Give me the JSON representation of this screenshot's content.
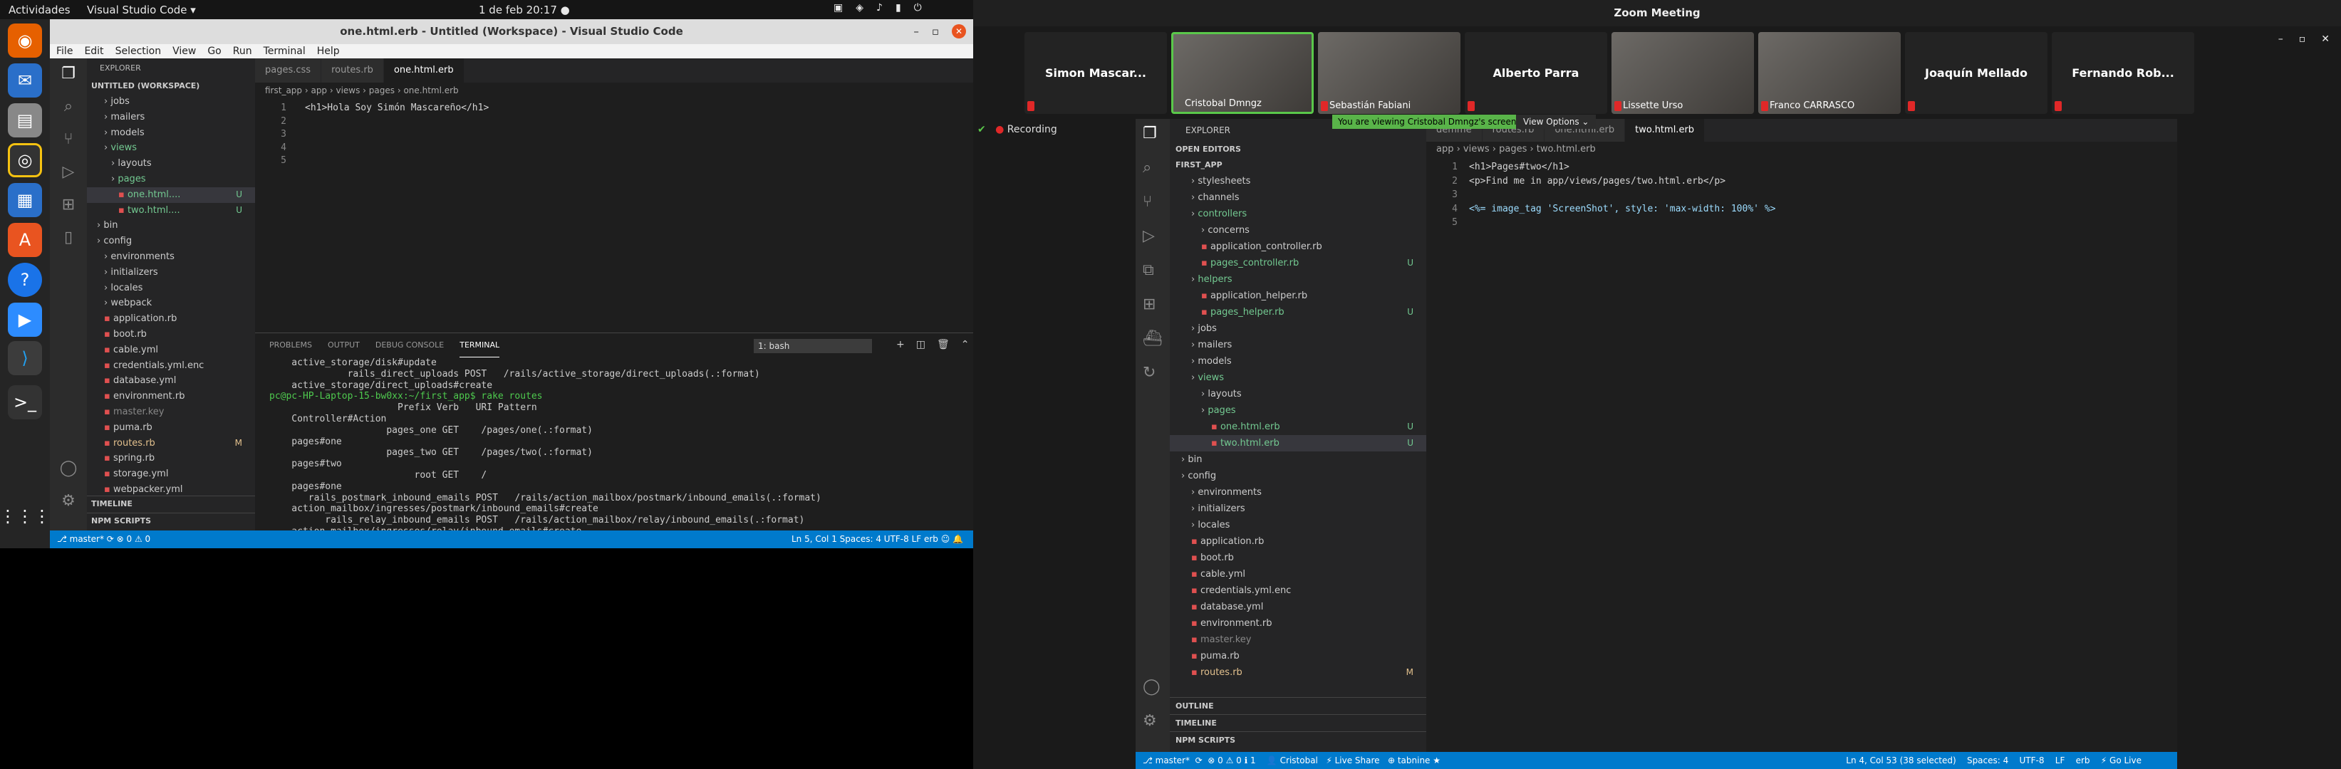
{
  "topbar": {
    "activities": "Actividades",
    "app": "Visual Studio Code ▾",
    "clock": "1 de feb  20:17  ●"
  },
  "vscode": {
    "title": "one.html.erb - Untitled (Workspace) - Visual Studio Code",
    "menu": [
      "File",
      "Edit",
      "Selection",
      "View",
      "Go",
      "Run",
      "Terminal",
      "Help"
    ],
    "explorer_label": "EXPLORER",
    "workspace": "UNTITLED (WORKSPACE)",
    "tree": [
      {
        "t": "jobs",
        "d": 1,
        "f": 1
      },
      {
        "t": "mailers",
        "d": 1,
        "f": 1
      },
      {
        "t": "models",
        "d": 1,
        "f": 1
      },
      {
        "t": "views",
        "d": 1,
        "f": 1,
        "c": "#73c991"
      },
      {
        "t": "layouts",
        "d": 2,
        "f": 1
      },
      {
        "t": "pages",
        "d": 2,
        "f": 1,
        "c": "#73c991"
      },
      {
        "t": "one.html....",
        "d": 3,
        "m": "U",
        "c": "#73c991",
        "sel": true
      },
      {
        "t": "two.html....",
        "d": 3,
        "m": "U",
        "c": "#73c991"
      },
      {
        "t": "bin",
        "d": 0,
        "f": 1
      },
      {
        "t": "config",
        "d": 0,
        "f": 1
      },
      {
        "t": "environments",
        "d": 1,
        "f": 1
      },
      {
        "t": "initializers",
        "d": 1,
        "f": 1
      },
      {
        "t": "locales",
        "d": 1,
        "f": 1
      },
      {
        "t": "webpack",
        "d": 1,
        "f": 1
      },
      {
        "t": "application.rb",
        "d": 1
      },
      {
        "t": "boot.rb",
        "d": 1
      },
      {
        "t": "cable.yml",
        "d": 1
      },
      {
        "t": "credentials.yml.enc",
        "d": 1
      },
      {
        "t": "database.yml",
        "d": 1
      },
      {
        "t": "environment.rb",
        "d": 1
      },
      {
        "t": "master.key",
        "d": 1,
        "c": "#888"
      },
      {
        "t": "puma.rb",
        "d": 1
      },
      {
        "t": "routes.rb",
        "d": 1,
        "m": "M",
        "c": "#e2c08d"
      },
      {
        "t": "spring.rb",
        "d": 1
      },
      {
        "t": "storage.yml",
        "d": 1
      },
      {
        "t": "webpacker.yml",
        "d": 1
      }
    ],
    "timeline": "TIMELINE",
    "npm": "NPM SCRIPTS",
    "tabs": [
      "pages.css",
      "routes.rb",
      "one.html.erb"
    ],
    "crumb": "first_app › app › views › pages › one.html.erb",
    "lines": [
      "1",
      "2",
      "3",
      "4",
      "5"
    ],
    "code": [
      "<h1>Hola Soy Simón Mascareño</h1>",
      "",
      "",
      "",
      ""
    ],
    "panel_tabs": [
      "PROBLEMS",
      "OUTPUT",
      "DEBUG CONSOLE",
      "TERMINAL"
    ],
    "shell": "1: bash",
    "terminal": [
      "    active_storage/disk#update",
      "              rails_direct_uploads POST   /rails/active_storage/direct_uploads(.:format)",
      "    active_storage/direct_uploads#create",
      "pc@pc-HP-Laptop-15-bw0xx:~/first_app$ rake routes",
      "                       Prefix Verb   URI Pattern",
      "    Controller#Action",
      "                     pages_one GET    /pages/one(.:format)",
      "    pages#one",
      "                     pages_two GET    /pages/two(.:format)",
      "    pages#two",
      "                          root GET    /",
      "    pages#one",
      "       rails_postmark_inbound_emails POST   /rails/action_mailbox/postmark/inbound_emails(.:format)",
      "    action_mailbox/ingresses/postmark/inbound_emails#create",
      "          rails_relay_inbound_emails POST   /rails/action_mailbox/relay/inbound_emails(.:format)",
      "    action_mailbox/ingresses/relay/inbound_emails#create"
    ],
    "status_left": "⎇ master*  ⟳  ⊗ 0 ⚠ 0",
    "status_right": "Ln 5, Col 1    Spaces: 4    UTF-8    LF    erb    ☺    🔔"
  },
  "zoom": {
    "title": "Zoom Meeting",
    "participants": [
      {
        "name": "Simon Mascar...",
        "label": "",
        "video": false
      },
      {
        "name": "",
        "label": "Cristobal Dmngz",
        "video": true,
        "active": true
      },
      {
        "name": "",
        "label": "Sebastián Fabiani",
        "video": true
      },
      {
        "name": "Alberto Parra",
        "label": "",
        "video": false
      },
      {
        "name": "",
        "label": "Lissette Urso",
        "video": true
      },
      {
        "name": "",
        "label": "Franco CARRASCO",
        "video": true
      },
      {
        "name": "Joaquín Mellado",
        "label": "",
        "video": false
      },
      {
        "name": "Fernando Rob...",
        "label": "",
        "video": false
      }
    ],
    "recording": "Recording",
    "viewing": "You are viewing Cristobal Dmngz's screen",
    "view_options": "View Options ⌄",
    "shared": {
      "tabs": [
        "demme",
        "routes.rb",
        "one.html.erb",
        "two.html.erb"
      ],
      "explorer_label": "EXPLORER",
      "open_editors": "OPEN EDITORS",
      "project": "FIRST_APP",
      "tree": [
        {
          "t": "stylesheets",
          "d": 1,
          "f": 1
        },
        {
          "t": "channels",
          "d": 1,
          "f": 1
        },
        {
          "t": "controllers",
          "d": 1,
          "f": 1,
          "c": "#73c991"
        },
        {
          "t": "concerns",
          "d": 2,
          "f": 1
        },
        {
          "t": "application_controller.rb",
          "d": 2
        },
        {
          "t": "pages_controller.rb",
          "d": 2,
          "m": "U",
          "c": "#73c991"
        },
        {
          "t": "helpers",
          "d": 1,
          "f": 1,
          "c": "#73c991"
        },
        {
          "t": "application_helper.rb",
          "d": 2
        },
        {
          "t": "pages_helper.rb",
          "d": 2,
          "m": "U",
          "c": "#73c991"
        },
        {
          "t": "jobs",
          "d": 1,
          "f": 1
        },
        {
          "t": "mailers",
          "d": 1,
          "f": 1
        },
        {
          "t": "models",
          "d": 1,
          "f": 1
        },
        {
          "t": "views",
          "d": 1,
          "f": 1,
          "c": "#73c991"
        },
        {
          "t": "layouts",
          "d": 2,
          "f": 1
        },
        {
          "t": "pages",
          "d": 2,
          "f": 1,
          "c": "#73c991"
        },
        {
          "t": "one.html.erb",
          "d": 3,
          "m": "U",
          "c": "#73c991"
        },
        {
          "t": "two.html.erb",
          "d": 3,
          "m": "U",
          "c": "#73c991",
          "sel": true
        },
        {
          "t": "bin",
          "d": 0,
          "f": 1
        },
        {
          "t": "config",
          "d": 0,
          "f": 1
        },
        {
          "t": "environments",
          "d": 1,
          "f": 1
        },
        {
          "t": "initializers",
          "d": 1,
          "f": 1
        },
        {
          "t": "locales",
          "d": 1,
          "f": 1
        },
        {
          "t": "application.rb",
          "d": 1
        },
        {
          "t": "boot.rb",
          "d": 1
        },
        {
          "t": "cable.yml",
          "d": 1
        },
        {
          "t": "credentials.yml.enc",
          "d": 1
        },
        {
          "t": "database.yml",
          "d": 1
        },
        {
          "t": "environment.rb",
          "d": 1
        },
        {
          "t": "master.key",
          "d": 1,
          "c": "#888"
        },
        {
          "t": "puma.rb",
          "d": 1
        },
        {
          "t": "routes.rb",
          "d": 1,
          "m": "M",
          "c": "#e2c08d"
        }
      ],
      "outline": "OUTLINE",
      "timeline": "TIMELINE",
      "npm": "NPM SCRIPTS",
      "crumb": "app › views › pages › two.html.erb",
      "lines": [
        "1",
        "2",
        "3",
        "4",
        "5"
      ],
      "code": [
        "<h1>Pages#two</h1>",
        "<p>Find me in app/views/pages/two.html.erb</p>",
        "",
        "<%= image_tag 'ScreenShot', style: 'max-width: 100%' %>",
        ""
      ],
      "status_left": "⎇ master*  ⟳  ⊗ 0 ⚠ 0 ℹ 1    👤 Cristobal   ⚡ Live Share   ⊕ tabnine ★",
      "status_right": "Ln 4, Col 53 (38 selected)    Spaces: 4    UTF-8    LF    erb    ⚡ Go Live"
    }
  },
  "colors": {
    "accent": "#007acc",
    "ubuntu_orange": "#e95420",
    "zoom_green": "#59b449"
  }
}
